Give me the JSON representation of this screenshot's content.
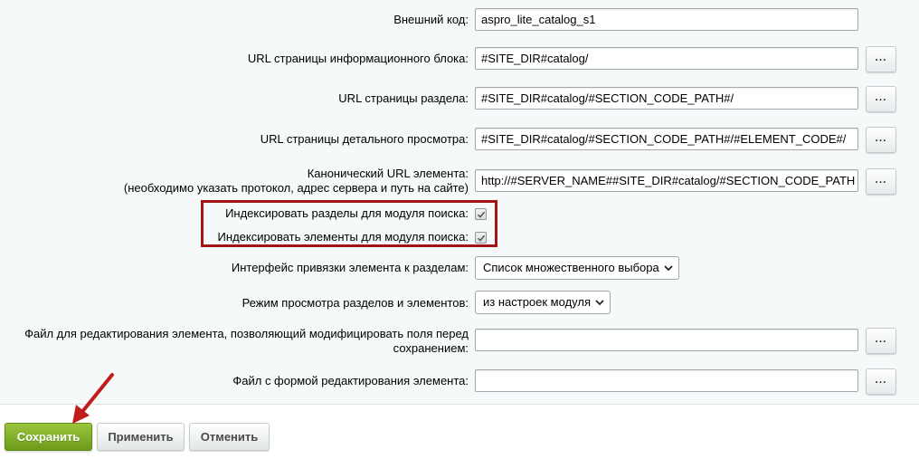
{
  "fields": {
    "external_code": {
      "label": "Внешний код:",
      "value": "aspro_lite_catalog_s1"
    },
    "iblock_url": {
      "label": "URL страницы информационного блока:",
      "value": "#SITE_DIR#catalog/",
      "button": "..."
    },
    "section_url": {
      "label": "URL страницы раздела:",
      "value": "#SITE_DIR#catalog/#SECTION_CODE_PATH#/",
      "button": "..."
    },
    "detail_url": {
      "label": "URL страницы детального просмотра:",
      "value": "#SITE_DIR#catalog/#SECTION_CODE_PATH#/#ELEMENT_CODE#/",
      "button": "..."
    },
    "canonical_url": {
      "label_line1": "Канонический URL элемента:",
      "label_line2": "(необходимо указать протокол, адрес сервера и путь на сайте)",
      "value": "http://#SERVER_NAME##SITE_DIR#catalog/#SECTION_CODE_PATH",
      "button": "..."
    },
    "index_sections": {
      "label": "Индексировать разделы для модуля поиска:",
      "checked": true
    },
    "index_elements": {
      "label": "Индексировать элементы для модуля поиска:",
      "checked": true
    },
    "section_binding": {
      "label": "Интерфейс привязки элемента к разделам:",
      "selected": "Список множественного выбора"
    },
    "view_mode": {
      "label": "Режим просмотра разделов и элементов:",
      "selected": "из настроек модуля"
    },
    "edit_file": {
      "label_line1": "Файл для редактирования элемента, позволяющий модифицировать поля перед",
      "label_line2": "сохранением:",
      "value": "",
      "button": "..."
    },
    "edit_form_file": {
      "label": "Файл с формой редактирования элемента:",
      "value": "",
      "button": "..."
    }
  },
  "footer": {
    "save_label": "Сохранить",
    "apply_label": "Применить",
    "cancel_label": "Отменить"
  },
  "colors": {
    "highlight": "#a31515",
    "save_button": "#7aa824",
    "form_background": "#f5f9f9"
  }
}
